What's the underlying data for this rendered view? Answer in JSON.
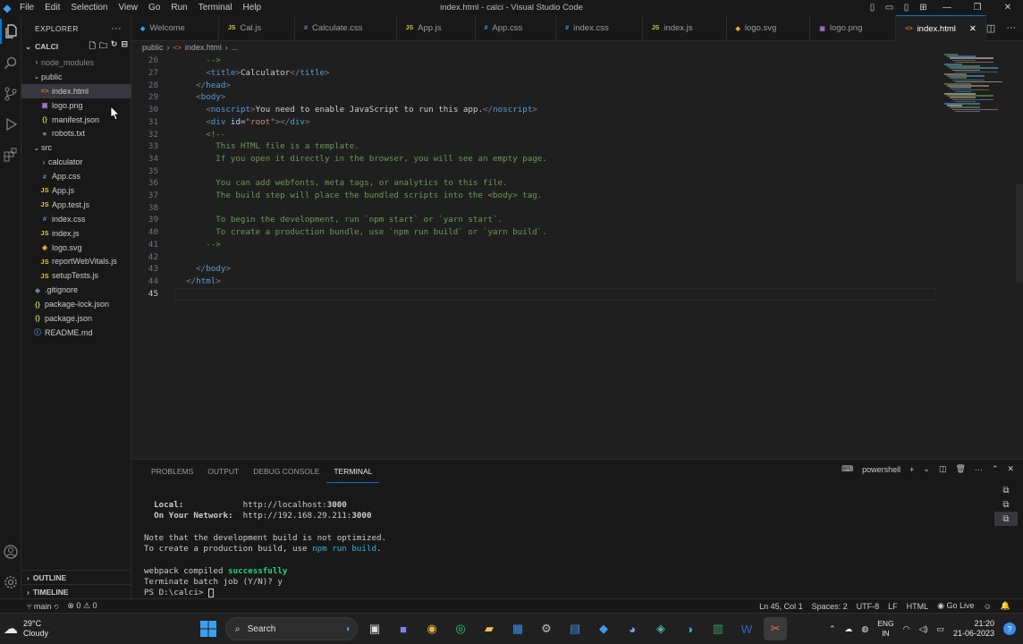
{
  "titlebar": {
    "menu": [
      "File",
      "Edit",
      "Selection",
      "View",
      "Go",
      "Run",
      "Terminal",
      "Help"
    ],
    "title": "index.html - calci - Visual Studio Code"
  },
  "sidebar": {
    "header": "EXPLORER",
    "project": "CALCI",
    "items": [
      {
        "label": "node_modules",
        "kind": "folder",
        "depth": 1,
        "expanded": false
      },
      {
        "label": "public",
        "kind": "folder",
        "depth": 1,
        "expanded": true
      },
      {
        "label": "index.html",
        "kind": "html",
        "depth": 2,
        "selected": true
      },
      {
        "label": "logo.png",
        "kind": "png",
        "depth": 2
      },
      {
        "label": "manifest.json",
        "kind": "json",
        "depth": 2
      },
      {
        "label": "robots.txt",
        "kind": "txt",
        "depth": 2
      },
      {
        "label": "src",
        "kind": "folder",
        "depth": 1,
        "expanded": true
      },
      {
        "label": "calculator",
        "kind": "folder",
        "depth": 2,
        "expanded": false
      },
      {
        "label": "App.css",
        "kind": "css",
        "depth": 2
      },
      {
        "label": "App.js",
        "kind": "js",
        "depth": 2
      },
      {
        "label": "App.test.js",
        "kind": "js",
        "depth": 2
      },
      {
        "label": "index.css",
        "kind": "css",
        "depth": 2
      },
      {
        "label": "index.js",
        "kind": "js",
        "depth": 2
      },
      {
        "label": "logo.svg",
        "kind": "svg",
        "depth": 2
      },
      {
        "label": "reportWebVitals.js",
        "kind": "js",
        "depth": 2
      },
      {
        "label": "setupTests.js",
        "kind": "js",
        "depth": 2
      },
      {
        "label": ".gitignore",
        "kind": "git",
        "depth": 1
      },
      {
        "label": "package-lock.json",
        "kind": "json",
        "depth": 1
      },
      {
        "label": "package.json",
        "kind": "json",
        "depth": 1
      },
      {
        "label": "README.md",
        "kind": "md",
        "depth": 1
      }
    ],
    "outline": "OUTLINE",
    "timeline": "TIMELINE"
  },
  "tabs": [
    {
      "label": "Welcome",
      "icon": "vscode-icon",
      "active": false
    },
    {
      "label": "Cal.js",
      "icon": "js-icon",
      "active": false
    },
    {
      "label": "Calculate.css",
      "icon": "css-icon",
      "active": false
    },
    {
      "label": "App.js",
      "icon": "js-icon",
      "active": false
    },
    {
      "label": "App.css",
      "icon": "css-icon",
      "active": false
    },
    {
      "label": "index.css",
      "icon": "css-icon",
      "active": false
    },
    {
      "label": "index.js",
      "icon": "js-icon",
      "active": false
    },
    {
      "label": "logo.svg",
      "icon": "svg-icon",
      "active": false
    },
    {
      "label": "logo.png",
      "icon": "image-icon",
      "active": false
    },
    {
      "label": "index.html",
      "icon": "html-icon",
      "active": true
    }
  ],
  "breadcrumb": [
    "public",
    "index.html",
    "..."
  ],
  "editor": {
    "current_line": "45",
    "lines": [
      {
        "n": "26",
        "tokens": [
          [
            "c-com",
            "      -->"
          ]
        ]
      },
      {
        "n": "27",
        "tokens": [
          [
            "c-txt",
            "      "
          ],
          [
            "c-brk",
            "<"
          ],
          [
            "c-tag",
            "title"
          ],
          [
            "c-brk",
            ">"
          ],
          [
            "c-txt",
            "Calculator"
          ],
          [
            "c-brk",
            "</"
          ],
          [
            "c-tag",
            "title"
          ],
          [
            "c-brk",
            ">"
          ]
        ]
      },
      {
        "n": "28",
        "tokens": [
          [
            "c-txt",
            "    "
          ],
          [
            "c-brk",
            "</"
          ],
          [
            "c-tag",
            "head"
          ],
          [
            "c-brk",
            ">"
          ]
        ]
      },
      {
        "n": "29",
        "tokens": [
          [
            "c-txt",
            "    "
          ],
          [
            "c-brk",
            "<"
          ],
          [
            "c-tag",
            "body"
          ],
          [
            "c-brk",
            ">"
          ]
        ]
      },
      {
        "n": "30",
        "tokens": [
          [
            "c-txt",
            "      "
          ],
          [
            "c-brk",
            "<"
          ],
          [
            "c-tag",
            "noscript"
          ],
          [
            "c-brk",
            ">"
          ],
          [
            "c-txt",
            "You need to enable JavaScript to run this app."
          ],
          [
            "c-brk",
            "</"
          ],
          [
            "c-tag",
            "noscript"
          ],
          [
            "c-brk",
            ">"
          ]
        ]
      },
      {
        "n": "31",
        "tokens": [
          [
            "c-txt",
            "      "
          ],
          [
            "c-brk",
            "<"
          ],
          [
            "c-tag",
            "div"
          ],
          [
            "c-txt",
            " "
          ],
          [
            "c-attr",
            "id"
          ],
          [
            "c-txt",
            "="
          ],
          [
            "c-str",
            "\"root\""
          ],
          [
            "c-brk",
            "></"
          ],
          [
            "c-tag",
            "div"
          ],
          [
            "c-brk",
            ">"
          ]
        ]
      },
      {
        "n": "32",
        "tokens": [
          [
            "c-com",
            "      <!--"
          ]
        ]
      },
      {
        "n": "33",
        "tokens": [
          [
            "c-com",
            "        This HTML file is a template."
          ]
        ]
      },
      {
        "n": "34",
        "tokens": [
          [
            "c-com",
            "        If you open it directly in the browser, you will see an empty page."
          ]
        ]
      },
      {
        "n": "35",
        "tokens": []
      },
      {
        "n": "36",
        "tokens": [
          [
            "c-com",
            "        You can add webfonts, meta tags, or analytics to this file."
          ]
        ]
      },
      {
        "n": "37",
        "tokens": [
          [
            "c-com",
            "        The build step will place the bundled scripts into the <body> tag."
          ]
        ]
      },
      {
        "n": "38",
        "tokens": []
      },
      {
        "n": "39",
        "tokens": [
          [
            "c-com",
            "        To begin the development, run `npm start` or `yarn start`."
          ]
        ]
      },
      {
        "n": "40",
        "tokens": [
          [
            "c-com",
            "        To create a production bundle, use `npm run build` or `yarn build`."
          ]
        ]
      },
      {
        "n": "41",
        "tokens": [
          [
            "c-com",
            "      -->"
          ]
        ]
      },
      {
        "n": "42",
        "tokens": []
      },
      {
        "n": "43",
        "tokens": [
          [
            "c-txt",
            "    "
          ],
          [
            "c-brk",
            "</"
          ],
          [
            "c-tag",
            "body"
          ],
          [
            "c-brk",
            ">"
          ]
        ]
      },
      {
        "n": "44",
        "tokens": [
          [
            "c-txt",
            "  "
          ],
          [
            "c-brk",
            "</"
          ],
          [
            "c-tag",
            "html"
          ],
          [
            "c-brk",
            ">"
          ]
        ]
      },
      {
        "n": "45",
        "tokens": []
      }
    ]
  },
  "panel": {
    "tabs": [
      "PROBLEMS",
      "OUTPUT",
      "DEBUG CONSOLE",
      "TERMINAL"
    ],
    "active_tab": "TERMINAL",
    "shell": "powershell",
    "terminal_lines": [
      [],
      [
        [
          "tb",
          "  Local:            "
        ],
        [
          "",
          "http://localhost:"
        ],
        [
          "tb",
          "3000"
        ]
      ],
      [
        [
          "tb",
          "  On Your Network:  "
        ],
        [
          "",
          "http://192.168.29.211:"
        ],
        [
          "tb",
          "3000"
        ]
      ],
      [],
      [
        [
          "",
          "Note that the development build is not optimized."
        ]
      ],
      [
        [
          "",
          "To create a production build, use "
        ],
        [
          "tcyan",
          "npm run build"
        ],
        [
          "",
          "."
        ]
      ],
      [],
      [
        [
          "",
          "webpack compiled "
        ],
        [
          "tgreen",
          "successfully"
        ]
      ],
      [
        [
          "",
          "Terminate batch job (Y/N)? y"
        ]
      ],
      [
        [
          "",
          "PS D:\\calci> "
        ]
      ]
    ]
  },
  "statusbar": {
    "branch": "main",
    "errors": "0",
    "warnings": "0",
    "position": "Ln 45, Col 1",
    "spaces": "Spaces: 2",
    "encoding": "UTF-8",
    "eol": "LF",
    "language": "HTML",
    "golive": "Go Live"
  },
  "taskbar": {
    "temp": "29°C",
    "condition": "Cloudy",
    "search": "Search",
    "lang1": "ENG",
    "lang2": "IN",
    "time": "21:20",
    "date": "21-06-2023"
  },
  "colors": {
    "accent": "#0078d4",
    "tag": "#569cd6",
    "comment": "#6a9955",
    "string": "#ce9178"
  }
}
